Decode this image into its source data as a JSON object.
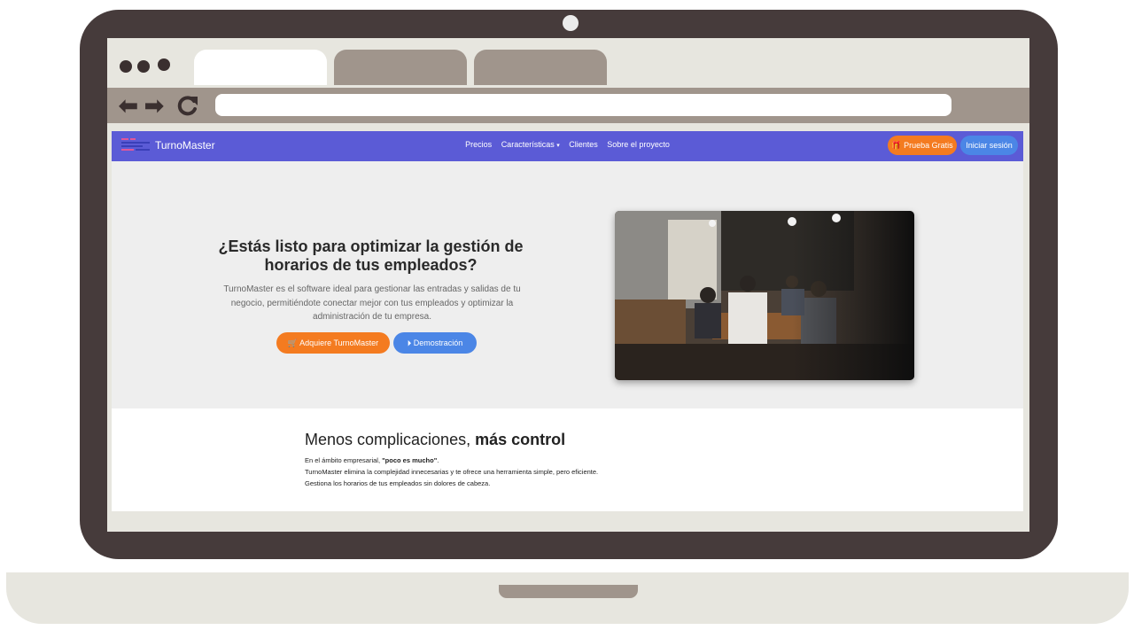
{
  "site": {
    "brand": "TurnoMaster",
    "nav": {
      "links": [
        "Precios",
        "Características",
        "Clientes",
        "Sobre el proyecto"
      ],
      "trial_button": "Prueba Gratis",
      "login_button": "Iniciar sesión"
    },
    "hero": {
      "title": "¿Estás listo para optimizar la gestión de horarios de tus empleados?",
      "description": "TurnoMaster es el software ideal para gestionar las entradas y salidas de tu negocio, permitiéndote conectar mejor con tus empleados y optimizar la administración de tu empresa.",
      "buy_button": "Adquiere TurnoMaster",
      "demo_button": "Demostración"
    },
    "section2": {
      "title_regular": "Menos complicaciones,",
      "title_bold": "más control",
      "line1_prefix": "En el ámbito empresarial, ",
      "line1_bold": "\"poco es mucho\"",
      "line1_suffix": ".",
      "line2": "TurnoMaster elimina la complejidad innecesarias y te ofrece una herramienta simple, pero eficiente.",
      "line3": "Gestiona los horarios de tus empleados sin dolores de cabeza."
    }
  },
  "colors": {
    "bezel": "#463b3b",
    "browser_chrome": "#e7e6df",
    "toolbar": "#a0958c",
    "navbar": "#5b5bd6",
    "accent_orange": "#f47b20",
    "accent_blue": "#4b86e6"
  },
  "icons": [
    "back-arrow-icon",
    "forward-arrow-icon",
    "reload-icon",
    "menu-logo-icon",
    "gift-icon",
    "caret-down-icon",
    "cart-icon",
    "play-circle-icon"
  ]
}
